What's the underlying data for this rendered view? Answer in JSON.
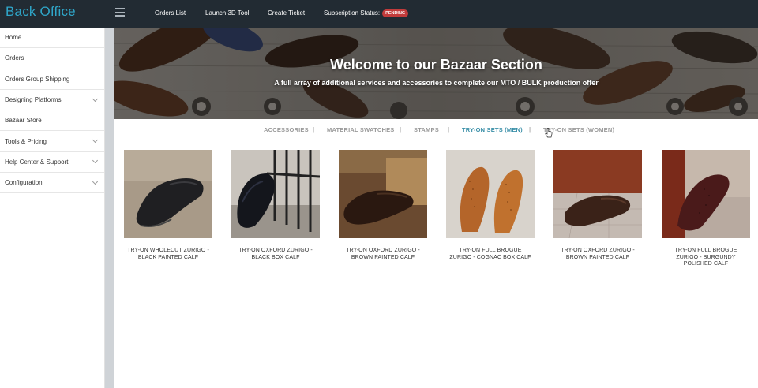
{
  "brand": "Back Office",
  "topnav": {
    "orders_list": "Orders List",
    "launch_3d": "Launch 3D Tool",
    "create_ticket": "Create Ticket",
    "subscription_label": "Subscription Status:",
    "subscription_status": "PENDING",
    "status_color": "#c23b3b"
  },
  "sidebar": {
    "items": [
      {
        "label": "Home",
        "has_chevron": false
      },
      {
        "label": "Orders",
        "has_chevron": false
      },
      {
        "label": "Orders Group Shipping",
        "has_chevron": false
      },
      {
        "label": "Designing Platforms",
        "has_chevron": true
      },
      {
        "label": "Bazaar Store",
        "has_chevron": false
      },
      {
        "label": "Tools & Pricing",
        "has_chevron": true
      },
      {
        "label": "Help Center & Support",
        "has_chevron": true
      },
      {
        "label": "Configuration",
        "has_chevron": true
      }
    ]
  },
  "hero": {
    "title": "Welcome to our Bazaar Section",
    "subtitle": "A full array of additional services and accessories to complete our MTO / BULK production offer"
  },
  "tabs": [
    {
      "label": "ACCESSORIES",
      "active": false
    },
    {
      "label": "MATERIAL SWATCHES",
      "active": false
    },
    {
      "label": "STAMPS",
      "active": false
    },
    {
      "label": "TRY-ON SETS (MEN)",
      "active": true
    },
    {
      "label": "TRY-ON SETS (WOMEN)",
      "active": false
    }
  ],
  "tab_separator": "|",
  "accent_color": "#3a8fa8",
  "products": [
    {
      "name": "TRY-ON WHOLECUT ZURIGO - BLACK PAINTED CALF"
    },
    {
      "name": "TRY-ON OXFORD ZURIGO - BLACK BOX CALF"
    },
    {
      "name": "TRY-ON OXFORD ZURIGO - BROWN PAINTED CALF"
    },
    {
      "name": "TRY-ON FULL BROGUE ZURIGO - COGNAC BOX CALF"
    },
    {
      "name": "TRY-ON OXFORD ZURIGO - BROWN PAINTED CALF"
    },
    {
      "name": "TRY-ON FULL BROGUE ZURIGO - BURGUNDY POLISHED CALF"
    }
  ]
}
